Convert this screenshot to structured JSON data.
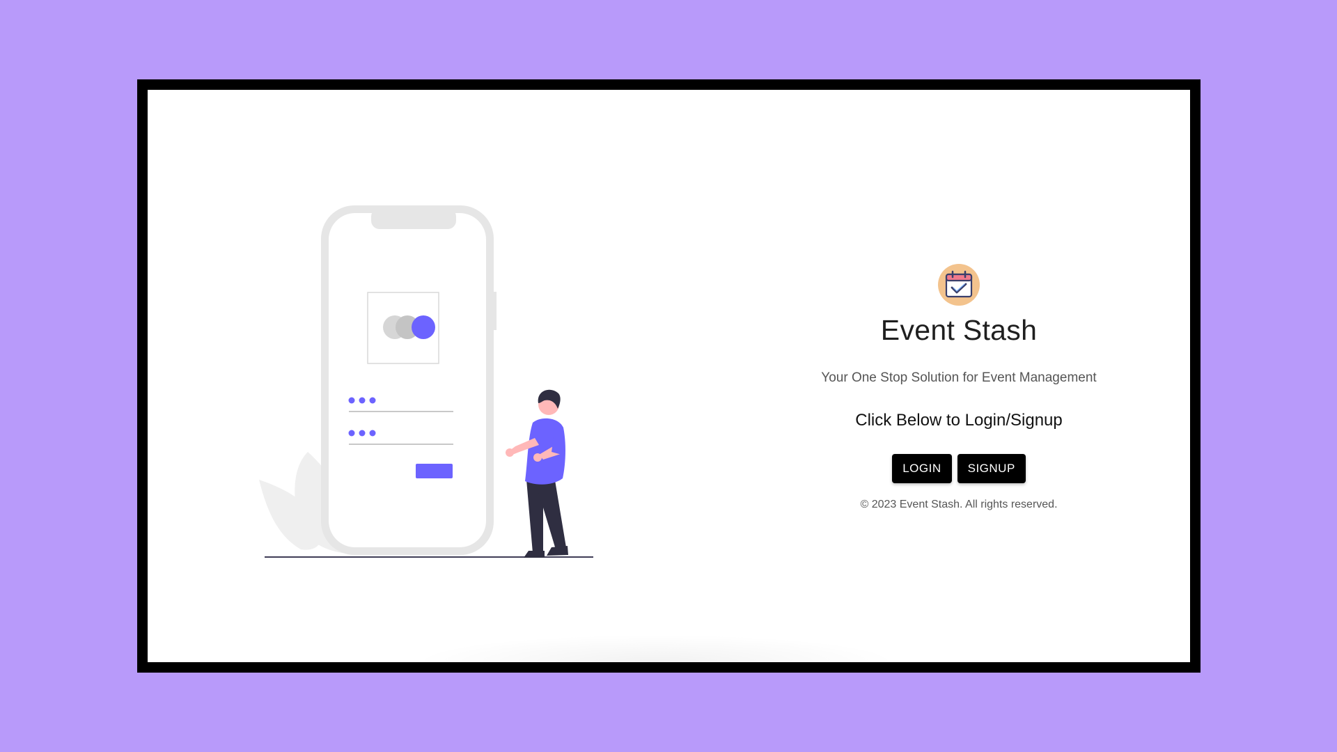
{
  "app": {
    "title": "Event Stash",
    "tagline": "Your One Stop Solution for Event Management",
    "cta": "Click Below to Login/Signup",
    "copyright": "© 2023 Event Stash. All rights reserved.",
    "logo_icon": "calendar-check-icon"
  },
  "buttons": {
    "login_label": "LOGIN",
    "signup_label": "SIGNUP"
  },
  "illustration": {
    "icon": "person-with-phone-login-illustration"
  },
  "colors": {
    "background": "#b89afa",
    "accent": "#6c63ff",
    "button": "#000000",
    "logo_circle": "#f3c38d"
  }
}
